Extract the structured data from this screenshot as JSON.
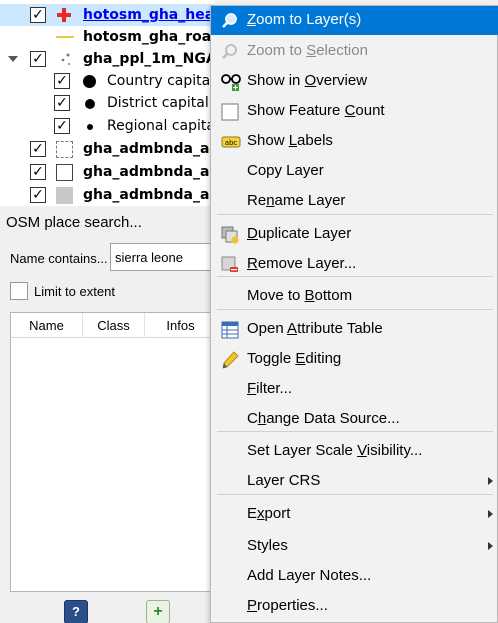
{
  "layers": {
    "rows": [
      {
        "label": "hotosm_gha_healt",
        "checked": "✓",
        "style": "link",
        "symbol": "red-cross-icon"
      },
      {
        "label": "hotosm_gha_roads",
        "checked": "",
        "style": "bold",
        "symbol": "line-symbol-icon"
      },
      {
        "label": "gha_ppl_1m_NGA",
        "checked": "✓",
        "style": "bold",
        "symbol": "categorized-points-icon"
      },
      {
        "label": "Country capital",
        "checked": "✓",
        "style": "reg",
        "symbol": "large-dot-icon"
      },
      {
        "label": "District capital",
        "checked": "✓",
        "style": "reg",
        "symbol": "medium-dot-icon"
      },
      {
        "label": "Regional capital",
        "checked": "✓",
        "style": "reg",
        "symbol": "small-dot-icon"
      },
      {
        "label": "gha_admbnda_adr",
        "checked": "✓",
        "style": "bold",
        "symbol": "dashed-polygon-icon"
      },
      {
        "label": "gha_admbnda_adr",
        "checked": "✓",
        "style": "bold",
        "symbol": "white-polygon-icon"
      },
      {
        "label": "gha_admbnda_adr",
        "checked": "✓",
        "style": "bold",
        "symbol": "grey-polygon-icon"
      }
    ]
  },
  "osm_panel": {
    "title": "OSM place search...",
    "name_label": "Name contains...",
    "search_value": "sierra leone",
    "limit_label": "Limit to extent",
    "columns": [
      "Name",
      "Class",
      "Infos"
    ],
    "help_glyph": "?",
    "add_glyph": "+"
  },
  "context_menu": {
    "items": [
      {
        "pre": "",
        "u": "Z",
        "post": "oom to Layer(s)",
        "icon": "zoom-to-layer-icon",
        "state": "highlighted"
      },
      {
        "pre": "Zoom to ",
        "u": "S",
        "post": "election",
        "icon": "zoom-to-selection-icon",
        "state": "disabled"
      },
      {
        "pre": "Show in ",
        "u": "O",
        "post": "verview",
        "icon": "show-in-overview-icon",
        "state": "normal"
      },
      {
        "pre": "Show Feature ",
        "u": "C",
        "post": "ount",
        "icon": "feature-count-checkbox-icon",
        "state": "normal"
      },
      {
        "pre": "Show ",
        "u": "L",
        "post": "abels",
        "icon": "labels-icon",
        "state": "normal"
      },
      {
        "pre": "Copy Layer",
        "u": "",
        "post": "",
        "icon": "",
        "state": "normal"
      },
      {
        "pre": "Re",
        "u": "n",
        "post": "ame Layer",
        "icon": "",
        "state": "normal"
      },
      {
        "pre": "",
        "u": "D",
        "post": "uplicate Layer",
        "icon": "duplicate-layer-icon",
        "state": "normal"
      },
      {
        "pre": "",
        "u": "R",
        "post": "emove Layer...",
        "icon": "remove-layer-icon",
        "state": "normal"
      },
      {
        "pre": "Move to ",
        "u": "B",
        "post": "ottom",
        "icon": "",
        "state": "normal"
      },
      {
        "pre": "Open ",
        "u": "A",
        "post": "ttribute Table",
        "icon": "attribute-table-icon",
        "state": "normal"
      },
      {
        "pre": "Toggle ",
        "u": "E",
        "post": "diting",
        "icon": "pencil-icon",
        "state": "normal"
      },
      {
        "pre": "",
        "u": "F",
        "post": "ilter...",
        "icon": "",
        "state": "normal"
      },
      {
        "pre": "C",
        "u": "h",
        "post": "ange Data Source...",
        "icon": "",
        "state": "normal"
      },
      {
        "pre": "Set Layer Scale ",
        "u": "V",
        "post": "isibility...",
        "icon": "",
        "state": "normal"
      },
      {
        "pre": "Layer CRS",
        "u": "",
        "post": "",
        "icon": "",
        "state": "submenu"
      },
      {
        "pre": "E",
        "u": "x",
        "post": "port",
        "icon": "",
        "state": "submenu"
      },
      {
        "pre": "Styles",
        "u": "",
        "post": "",
        "icon": "",
        "state": "submenu"
      },
      {
        "pre": "Add Layer Notes...",
        "u": "",
        "post": "",
        "icon": "",
        "state": "normal"
      },
      {
        "pre": "",
        "u": "P",
        "post": "roperties...",
        "icon": "",
        "state": "normal"
      }
    ]
  }
}
